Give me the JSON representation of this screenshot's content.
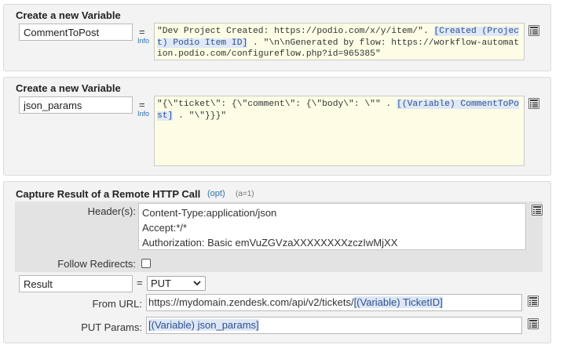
{
  "panel1": {
    "title": "Create a new Variable",
    "name_value": "CommentToPost",
    "equals": "=",
    "info": "Info",
    "code_before": "\"Dev Project Created: https://podio.com/x/y/item/\". ",
    "code_token": "[Created (Project) Podio Item ID]",
    "code_after": " . \"\\n\\nGenerated by flow: https://workflow-automation.podio.com/configureflow.php?id=965385\""
  },
  "panel2": {
    "title": "Create a new Variable",
    "name_value": "json_params",
    "equals": "=",
    "info": "Info",
    "code_before": "\"{\\\"ticket\\\": {\\\"comment\\\": {\\\"body\\\": \\\"\" . ",
    "code_token": "[(Variable) CommentToPost]",
    "code_after": " . \"\\\"}}}\""
  },
  "panel3": {
    "title": "Capture Result of a Remote HTTP Call",
    "opt": "(opt)",
    "a_count": "(a=1)",
    "headers_label": "Header(s):",
    "headers": [
      "Content-Type:application/json",
      "Accept:*/*",
      "Authorization: Basic emVuZGVzaXXXXXXXXzczIwMjXX"
    ],
    "follow_label": "Follow Redirects:",
    "follow_checked": false,
    "result_name": "Result",
    "equals": "=",
    "method": "PUT",
    "from_url_label": "From URL:",
    "url_prefix": "https://mydomain.zendesk.com/api/v2/tickets/",
    "url_token": "[(Variable) TicketID]",
    "put_params_label": "PUT Params:",
    "put_params_token": "[(Variable) json_params]"
  },
  "icons": {
    "doc_button": "field-list-icon",
    "select_arrow": "chevron-down-icon"
  }
}
